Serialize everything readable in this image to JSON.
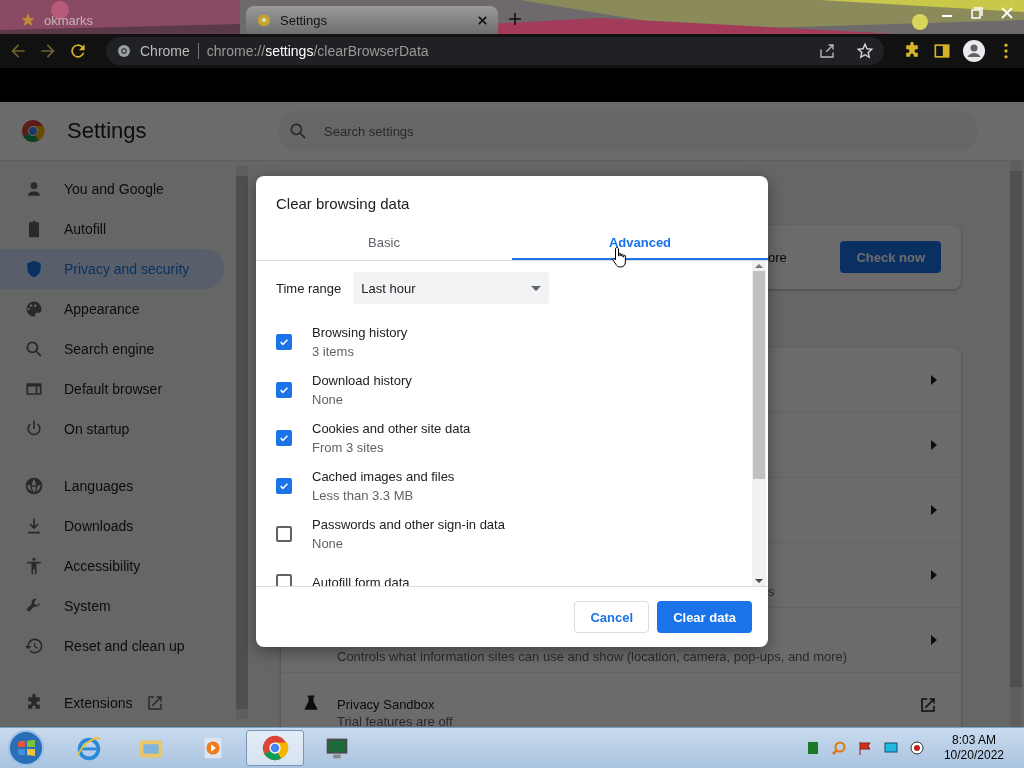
{
  "browser": {
    "tabs": [
      {
        "label": "okmarks",
        "selected": false
      },
      {
        "label": "Settings",
        "selected": true
      }
    ],
    "omnibox": {
      "site_label": "Chrome",
      "url": "chrome://**settings**/clearBrowserData"
    }
  },
  "settings": {
    "title": "Settings",
    "search": {
      "placeholder": "Search settings"
    },
    "sidebar": {
      "groups": [
        [
          {
            "label": "You and Google",
            "selected": false
          },
          {
            "label": "Autofill",
            "selected": false
          },
          {
            "label": "Privacy and security",
            "selected": true
          },
          {
            "label": "Appearance",
            "selected": false
          },
          {
            "label": "Search engine",
            "selected": false
          },
          {
            "label": "Default browser",
            "selected": false
          },
          {
            "label": "On startup",
            "selected": false
          }
        ],
        [
          {
            "label": "Languages",
            "selected": false
          },
          {
            "label": "Downloads",
            "selected": false
          },
          {
            "label": "Accessibility",
            "selected": false
          },
          {
            "label": "System",
            "selected": false
          },
          {
            "label": "Reset and clean up",
            "selected": false
          }
        ],
        [
          {
            "label": "Extensions",
            "selected": false
          }
        ]
      ]
    },
    "safety_check": {
      "text": "ore",
      "cut_left": true,
      "button": "Check now"
    },
    "rows": [
      {
        "kind": "arrow"
      },
      {
        "kind": "arrow"
      },
      {
        "kind": "arrow"
      },
      {
        "kind": "arrow",
        "subtitle": "s",
        "cut_left": true
      },
      {
        "kind": "arrow",
        "subtitle": "Controls what information sites can use and show (location, camera, pop-ups, and more)",
        "cut_left": false
      },
      {
        "kind": "external",
        "title": "Privacy Sandbox",
        "subtitle": "Trial features are off",
        "cut_left": false
      }
    ]
  },
  "dialog": {
    "title": "Clear browsing data",
    "tabs": [
      {
        "label": "Basic",
        "selected": false
      },
      {
        "label": "Advanced",
        "selected": true
      }
    ],
    "time_range": {
      "label": "Time range",
      "value": "Last hour"
    },
    "items": [
      {
        "title": "Browsing history",
        "subtitle": "3 items",
        "checked": true
      },
      {
        "title": "Download history",
        "subtitle": "None",
        "checked": true
      },
      {
        "title": "Cookies and other site data",
        "subtitle": "From 3 sites",
        "checked": true
      },
      {
        "title": "Cached images and files",
        "subtitle": "Less than 3.3 MB",
        "checked": true
      },
      {
        "title": "Passwords and other sign-in data",
        "subtitle": "None",
        "checked": false
      },
      {
        "title": "Autofill form data",
        "checked": false
      }
    ],
    "buttons": [
      {
        "label": "Cancel",
        "kind": "secondary"
      },
      {
        "label": "Clear data",
        "kind": "primary"
      }
    ]
  },
  "taskbar": {
    "apps": [
      {
        "selected": false
      },
      {
        "selected": false
      },
      {
        "selected": false
      },
      {
        "selected": true
      },
      {
        "selected": false
      }
    ],
    "clock": {
      "time": "8:03 AM",
      "date": "10/20/2022"
    }
  }
}
